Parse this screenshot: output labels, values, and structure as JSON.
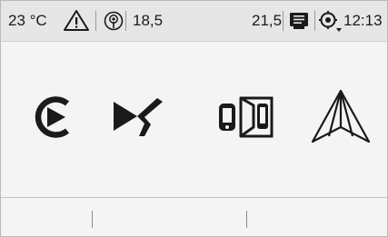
{
  "status_bar": {
    "outside_temperature": "23 °C",
    "left_zone_temperature": "18,5",
    "right_zone_temperature": "21,5",
    "time": "12:13",
    "icons": [
      "warning-icon",
      "connected-services-icon",
      "notes-icon",
      "gps-settings-icon"
    ]
  },
  "apps": [
    {
      "id": "carplay",
      "icon": "carplay-icon"
    },
    {
      "id": "ds-connect",
      "icon": "ds-logo-icon"
    },
    {
      "id": "mirror-link",
      "icon": "mirrorlink-icon"
    },
    {
      "id": "android-auto",
      "icon": "android-auto-icon"
    }
  ],
  "softkeys": [
    {
      "label": ""
    },
    {
      "label": ""
    },
    {
      "label": ""
    }
  ],
  "colors": {
    "background": "#f4f4f4",
    "status_bar": "#e6e6e6",
    "icon": "#1a1a1a"
  }
}
